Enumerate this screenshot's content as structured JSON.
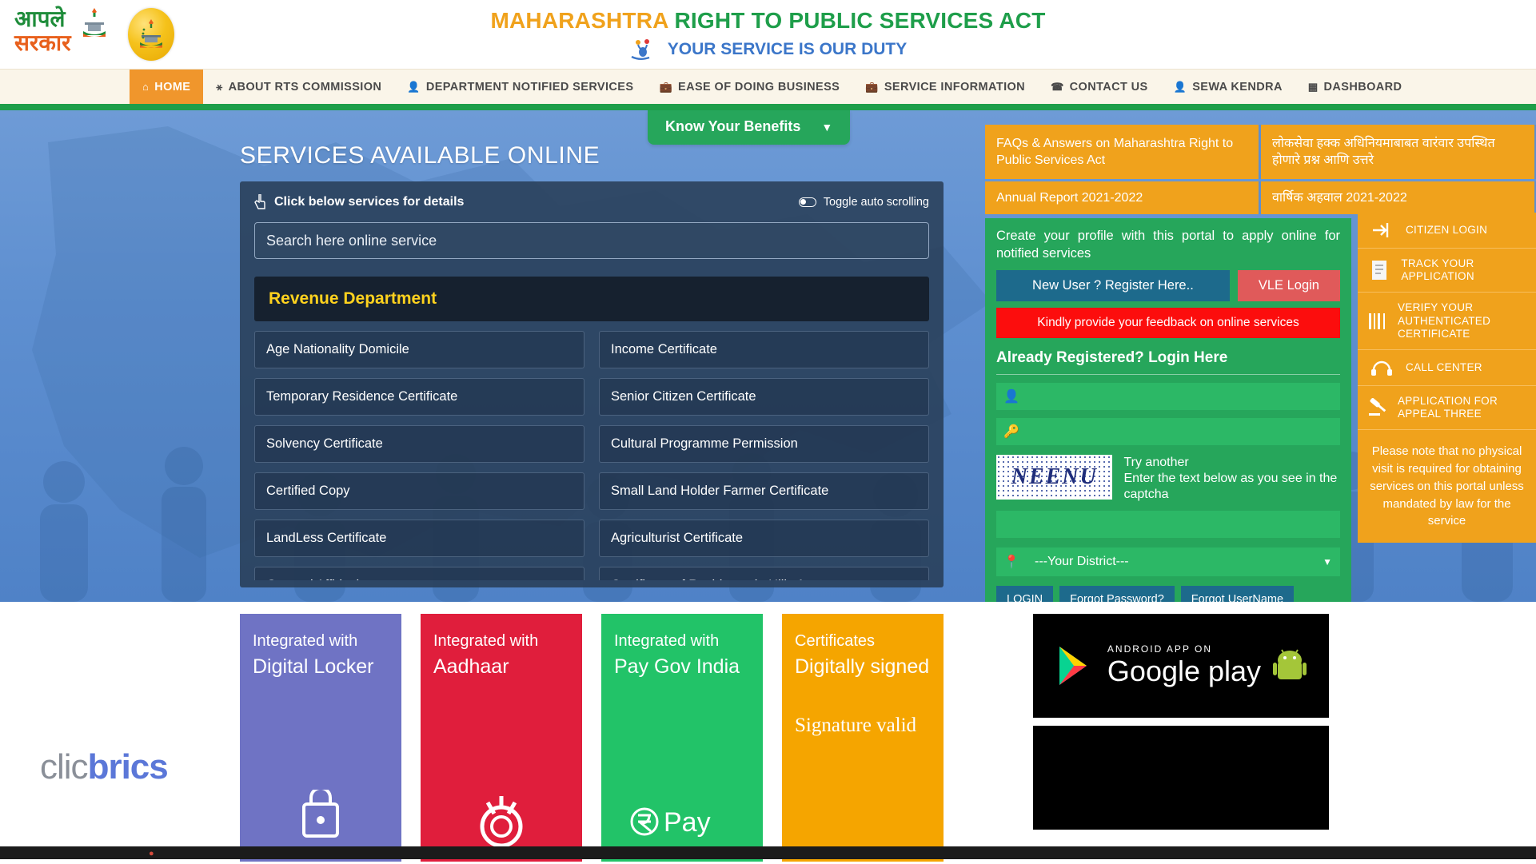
{
  "header": {
    "logo_line1": "आपले",
    "logo_line2": "सरकार",
    "title_part1": "MAHARASHTRA ",
    "title_part2": "RIGHT TO PUBLIC SERVICES ACT",
    "subtitle": "YOUR SERVICE IS OUR DUTY"
  },
  "nav": {
    "items": [
      {
        "label": "HOME",
        "icon": "home-icon",
        "glyph": "⌂",
        "active": true
      },
      {
        "label": "ABOUT RTS COMMISSION",
        "icon": "person-icon",
        "glyph": "Ɣ",
        "active": false
      },
      {
        "label": "DEPARTMENT NOTIFIED SERVICES",
        "icon": "user-icon",
        "glyph": "♟",
        "active": false
      },
      {
        "label": "EASE OF DOING BUSINESS",
        "icon": "briefcase-icon",
        "glyph": "▤",
        "active": false
      },
      {
        "label": "SERVICE INFORMATION",
        "icon": "briefcase-icon",
        "glyph": "▤",
        "active": false
      },
      {
        "label": "CONTACT US",
        "icon": "phone-icon",
        "glyph": "☎",
        "active": false
      },
      {
        "label": "SEWA KENDRA",
        "icon": "user-icon",
        "glyph": "♟",
        "active": false
      },
      {
        "label": "DASHBOARD",
        "icon": "dashboard-icon",
        "glyph": "▦",
        "active": false
      }
    ]
  },
  "know_your_benefits": {
    "label": "Know Your Benefits",
    "caret": "▼"
  },
  "services": {
    "heading": "SERVICES AVAILABLE ONLINE",
    "hint": "Click below services for details",
    "hint_icon": "pointing-hand-icon",
    "toggle_label": "Toggle auto scrolling",
    "search_placeholder": "Search here online service",
    "search_value": "",
    "department": "Revenue Department",
    "items": [
      "Age Nationality Domicile",
      "Income Certificate",
      "Temporary Residence Certificate",
      "Senior Citizen Certificate",
      "Solvency Certificate",
      "Cultural Programme Permission",
      "Certified Copy",
      "Small Land Holder Farmer Certificate",
      "LandLess Certificate",
      "Agriculturist Certificate",
      "General Affidavit",
      "Certificate of Residence in Hilly Area"
    ]
  },
  "info_boxes": {
    "faq_en": "FAQs & Answers on Maharashtra Right to Public Services Act",
    "faq_mr": "लोकसेवा हक्क अधिनियमाबाबत वारंवार उपस्थित होणारे प्रश्न आणि उत्तरे",
    "report_en": "Annual Report 2021-2022",
    "report_mr": "वार्षिक अहवाल 2021-2022"
  },
  "login_panel": {
    "intro": "Create your profile with this portal to apply online for notified services",
    "register_label": "New User ? Register Here..",
    "vle_label": "VLE Login",
    "feedback_label": "Kindly provide your feedback on online services",
    "already_registered": "Already Registered? Login Here",
    "username_placeholder": "",
    "username_value": "",
    "username_icon": "user-icon",
    "password_placeholder": "",
    "password_value": "",
    "password_icon": "key-icon",
    "captcha_text": "NEENU",
    "captcha_try_another": "Try another",
    "captcha_instruction": "Enter the text below as you see in the captcha",
    "captcha_input_value": "",
    "district_icon": "location-pin-icon",
    "district_selected": "---Your District---",
    "district_options": [
      "---Your District---"
    ],
    "btn_login": "LOGIN",
    "btn_forgot_password": "Forgot Password?",
    "btn_forgot_username": "Forgot UserName"
  },
  "side_menu": {
    "items": [
      {
        "label": "CITIZEN LOGIN",
        "icon": "login-arrow-icon",
        "glyph": "➡"
      },
      {
        "label": "TRACK YOUR APPLICATION",
        "icon": "document-icon",
        "glyph": "Ὄ4"
      },
      {
        "label": "VERIFY YOUR AUTHENTICATED CERTIFICATE",
        "icon": "barcode-icon",
        "glyph": "‖"
      },
      {
        "label": "CALL CENTER",
        "icon": "headset-icon",
        "glyph": "☎"
      },
      {
        "label": "APPLICATION FOR APPEAL THREE",
        "icon": "gavel-icon",
        "glyph": "⚒"
      }
    ],
    "note": "Please note that no physical visit is required for obtaining services on this portal unless mandated by law for the service"
  },
  "footer": {
    "brand_part1": "clic",
    "brand_part2": "brics",
    "tiles": [
      {
        "line1": "Integrated with",
        "line2": "Digital Locker",
        "color": "purple"
      },
      {
        "line1": "Integrated with",
        "line2": "Aadhaar",
        "color": "red"
      },
      {
        "line1": "Integrated with",
        "line2": "Pay Gov India",
        "color": "green"
      },
      {
        "line1": "Certificates",
        "line2": "Digitally signed",
        "line3": "Signature valid",
        "color": "orange"
      }
    ],
    "playstore_small": "ANDROID APP ON",
    "playstore_large": "Google play"
  },
  "taskbar": {
    "clock": ""
  }
}
